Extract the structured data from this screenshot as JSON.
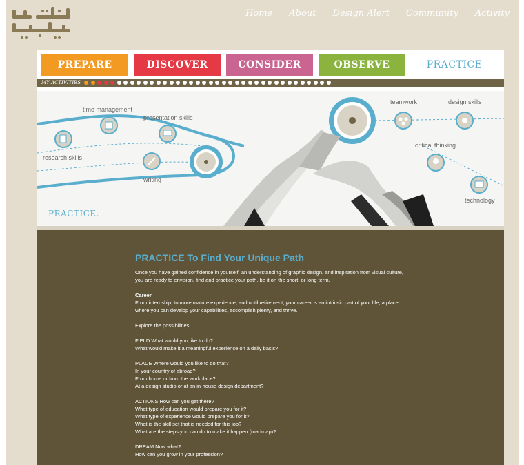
{
  "header": {
    "nav": [
      "Home",
      "About",
      "Design Alert",
      "Community",
      "Activity"
    ]
  },
  "tabs": [
    {
      "label": "PREPARE",
      "color": "#f39a22"
    },
    {
      "label": "DISCOVER",
      "color": "#e63946"
    },
    {
      "label": "CONSIDER",
      "color": "#c96590"
    },
    {
      "label": "OBSERVE",
      "color": "#8ab43e"
    },
    {
      "label": "PRACTICE",
      "color": "#ffffff"
    }
  ],
  "activities": {
    "label": "MY ACTIVITIES",
    "dot_colors": [
      "#f39a22",
      "#f39a22",
      "#e63946",
      "#e63946",
      "#e63946"
    ],
    "total_dots": 38
  },
  "hero": {
    "skills": [
      "time management",
      "presentation skills",
      "research skills",
      "writing",
      "teamwork",
      "design skills",
      "critical thinking",
      "technology"
    ],
    "label": "PRACTICE."
  },
  "content": {
    "title": "PRACTICE To Find Your Unique Path",
    "intro": "Once you have gained confidence in yourself, an understanding of graphic design, and inspiration from visual culture, you are ready to envision, find and practice your path, be it on the short, or long term.",
    "career_heading": "Career",
    "career_text": "From internship, to more mature experience, and until retirement, your career is an intrinsic part of your life, a place where you can develop your capabilities, accomplish plenty, and thrive.",
    "explore": "Explore the possibilities.",
    "field": [
      "FIELD What would you like to do?",
      "What would make it a meaningful experience on a daily basis?"
    ],
    "place": [
      "PLACE Where would you like to do that?",
      "In your country of abroad?",
      "From home or from the workplace?",
      "At a design studio or at an in-house design department?"
    ],
    "actions": [
      "ACTIONS How can you get there?",
      "What type of education would prepare you for it?",
      "What type of experience would prepare you for it?",
      "What is the skill set that is needed for this job?",
      "What are the steps you can do to make it happen (roadmap)?"
    ],
    "dream": [
      "DREAM Now what?",
      "How can you grow in your profession?"
    ]
  }
}
